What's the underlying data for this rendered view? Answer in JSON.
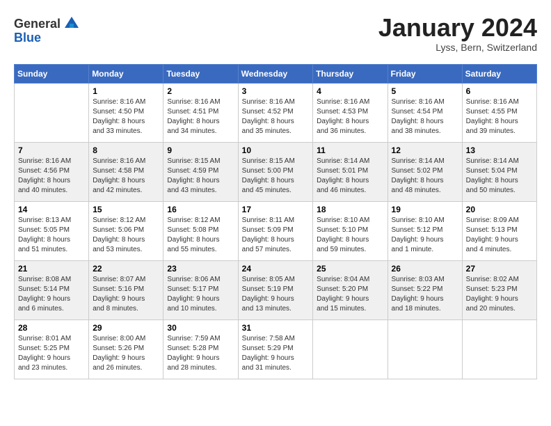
{
  "header": {
    "logo_general": "General",
    "logo_blue": "Blue",
    "month_title": "January 2024",
    "subtitle": "Lyss, Bern, Switzerland"
  },
  "days_of_week": [
    "Sunday",
    "Monday",
    "Tuesday",
    "Wednesday",
    "Thursday",
    "Friday",
    "Saturday"
  ],
  "weeks": [
    [
      {
        "day": "",
        "sunrise": "",
        "sunset": "",
        "daylight": ""
      },
      {
        "day": "1",
        "sunrise": "Sunrise: 8:16 AM",
        "sunset": "Sunset: 4:50 PM",
        "daylight": "Daylight: 8 hours and 33 minutes."
      },
      {
        "day": "2",
        "sunrise": "Sunrise: 8:16 AM",
        "sunset": "Sunset: 4:51 PM",
        "daylight": "Daylight: 8 hours and 34 minutes."
      },
      {
        "day": "3",
        "sunrise": "Sunrise: 8:16 AM",
        "sunset": "Sunset: 4:52 PM",
        "daylight": "Daylight: 8 hours and 35 minutes."
      },
      {
        "day": "4",
        "sunrise": "Sunrise: 8:16 AM",
        "sunset": "Sunset: 4:53 PM",
        "daylight": "Daylight: 8 hours and 36 minutes."
      },
      {
        "day": "5",
        "sunrise": "Sunrise: 8:16 AM",
        "sunset": "Sunset: 4:54 PM",
        "daylight": "Daylight: 8 hours and 38 minutes."
      },
      {
        "day": "6",
        "sunrise": "Sunrise: 8:16 AM",
        "sunset": "Sunset: 4:55 PM",
        "daylight": "Daylight: 8 hours and 39 minutes."
      }
    ],
    [
      {
        "day": "7",
        "sunrise": "Sunrise: 8:16 AM",
        "sunset": "Sunset: 4:56 PM",
        "daylight": "Daylight: 8 hours and 40 minutes."
      },
      {
        "day": "8",
        "sunrise": "Sunrise: 8:16 AM",
        "sunset": "Sunset: 4:58 PM",
        "daylight": "Daylight: 8 hours and 42 minutes."
      },
      {
        "day": "9",
        "sunrise": "Sunrise: 8:15 AM",
        "sunset": "Sunset: 4:59 PM",
        "daylight": "Daylight: 8 hours and 43 minutes."
      },
      {
        "day": "10",
        "sunrise": "Sunrise: 8:15 AM",
        "sunset": "Sunset: 5:00 PM",
        "daylight": "Daylight: 8 hours and 45 minutes."
      },
      {
        "day": "11",
        "sunrise": "Sunrise: 8:14 AM",
        "sunset": "Sunset: 5:01 PM",
        "daylight": "Daylight: 8 hours and 46 minutes."
      },
      {
        "day": "12",
        "sunrise": "Sunrise: 8:14 AM",
        "sunset": "Sunset: 5:02 PM",
        "daylight": "Daylight: 8 hours and 48 minutes."
      },
      {
        "day": "13",
        "sunrise": "Sunrise: 8:14 AM",
        "sunset": "Sunset: 5:04 PM",
        "daylight": "Daylight: 8 hours and 50 minutes."
      }
    ],
    [
      {
        "day": "14",
        "sunrise": "Sunrise: 8:13 AM",
        "sunset": "Sunset: 5:05 PM",
        "daylight": "Daylight: 8 hours and 51 minutes."
      },
      {
        "day": "15",
        "sunrise": "Sunrise: 8:12 AM",
        "sunset": "Sunset: 5:06 PM",
        "daylight": "Daylight: 8 hours and 53 minutes."
      },
      {
        "day": "16",
        "sunrise": "Sunrise: 8:12 AM",
        "sunset": "Sunset: 5:08 PM",
        "daylight": "Daylight: 8 hours and 55 minutes."
      },
      {
        "day": "17",
        "sunrise": "Sunrise: 8:11 AM",
        "sunset": "Sunset: 5:09 PM",
        "daylight": "Daylight: 8 hours and 57 minutes."
      },
      {
        "day": "18",
        "sunrise": "Sunrise: 8:10 AM",
        "sunset": "Sunset: 5:10 PM",
        "daylight": "Daylight: 8 hours and 59 minutes."
      },
      {
        "day": "19",
        "sunrise": "Sunrise: 8:10 AM",
        "sunset": "Sunset: 5:12 PM",
        "daylight": "Daylight: 9 hours and 1 minute."
      },
      {
        "day": "20",
        "sunrise": "Sunrise: 8:09 AM",
        "sunset": "Sunset: 5:13 PM",
        "daylight": "Daylight: 9 hours and 4 minutes."
      }
    ],
    [
      {
        "day": "21",
        "sunrise": "Sunrise: 8:08 AM",
        "sunset": "Sunset: 5:14 PM",
        "daylight": "Daylight: 9 hours and 6 minutes."
      },
      {
        "day": "22",
        "sunrise": "Sunrise: 8:07 AM",
        "sunset": "Sunset: 5:16 PM",
        "daylight": "Daylight: 9 hours and 8 minutes."
      },
      {
        "day": "23",
        "sunrise": "Sunrise: 8:06 AM",
        "sunset": "Sunset: 5:17 PM",
        "daylight": "Daylight: 9 hours and 10 minutes."
      },
      {
        "day": "24",
        "sunrise": "Sunrise: 8:05 AM",
        "sunset": "Sunset: 5:19 PM",
        "daylight": "Daylight: 9 hours and 13 minutes."
      },
      {
        "day": "25",
        "sunrise": "Sunrise: 8:04 AM",
        "sunset": "Sunset: 5:20 PM",
        "daylight": "Daylight: 9 hours and 15 minutes."
      },
      {
        "day": "26",
        "sunrise": "Sunrise: 8:03 AM",
        "sunset": "Sunset: 5:22 PM",
        "daylight": "Daylight: 9 hours and 18 minutes."
      },
      {
        "day": "27",
        "sunrise": "Sunrise: 8:02 AM",
        "sunset": "Sunset: 5:23 PM",
        "daylight": "Daylight: 9 hours and 20 minutes."
      }
    ],
    [
      {
        "day": "28",
        "sunrise": "Sunrise: 8:01 AM",
        "sunset": "Sunset: 5:25 PM",
        "daylight": "Daylight: 9 hours and 23 minutes."
      },
      {
        "day": "29",
        "sunrise": "Sunrise: 8:00 AM",
        "sunset": "Sunset: 5:26 PM",
        "daylight": "Daylight: 9 hours and 26 minutes."
      },
      {
        "day": "30",
        "sunrise": "Sunrise: 7:59 AM",
        "sunset": "Sunset: 5:28 PM",
        "daylight": "Daylight: 9 hours and 28 minutes."
      },
      {
        "day": "31",
        "sunrise": "Sunrise: 7:58 AM",
        "sunset": "Sunset: 5:29 PM",
        "daylight": "Daylight: 9 hours and 31 minutes."
      },
      {
        "day": "",
        "sunrise": "",
        "sunset": "",
        "daylight": ""
      },
      {
        "day": "",
        "sunrise": "",
        "sunset": "",
        "daylight": ""
      },
      {
        "day": "",
        "sunrise": "",
        "sunset": "",
        "daylight": ""
      }
    ]
  ]
}
